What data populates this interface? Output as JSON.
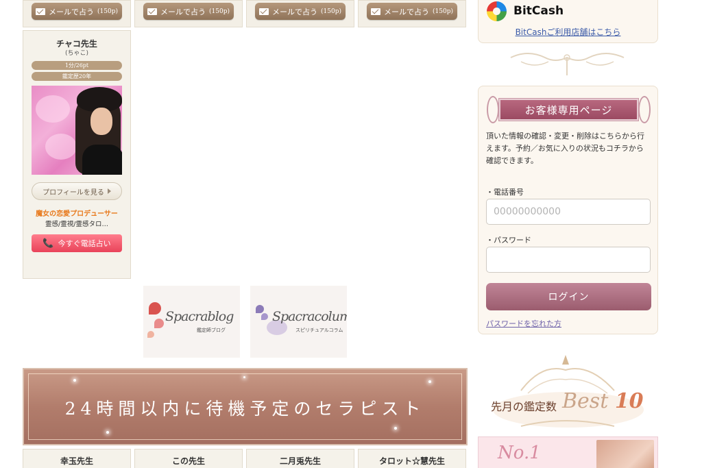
{
  "mail_buttons": [
    {
      "label": "メールで占う",
      "price": "(150p)"
    },
    {
      "label": "メールで占う",
      "price": "(150p)"
    },
    {
      "label": "メールで占う",
      "price": "(150p)"
    },
    {
      "label": "メールで占う",
      "price": "(150p)"
    }
  ],
  "teacher": {
    "name": "チャコ先生",
    "kana": "(ちゃこ)",
    "rate": "1分/26pt",
    "career": "鑑定歴20年",
    "profile_label": "プロフィールを見る",
    "catchphrase": "魔女の恋愛プロデューサー",
    "genres": "霊感/霊視/霊感タロ…",
    "call_label": "今すぐ電話占い"
  },
  "blog_banners": [
    {
      "script": "Spacrablog",
      "sub": "鑑定師ブログ"
    },
    {
      "script": "Spacracolum",
      "sub": "スピリチュアルコラム"
    }
  ],
  "wait_banner": {
    "title": "24時間以内に待機予定のセラピスト"
  },
  "bottom_teachers": [
    "幸玉先生",
    "この先生",
    "二月兎先生",
    "タロット☆慧先生"
  ],
  "sidebar": {
    "bitcash": {
      "name": "BitCash",
      "link": "BitCashご利用店舗はこちら"
    },
    "customer": {
      "title": "お客様専用ページ",
      "description": "頂いた情報の確認・変更・削除はこちらから行えます。予約／お気に入りの状況もコチラから確認できます。",
      "phone_label": "・電話番号",
      "phone_placeholder": "00000000000",
      "password_label": "・パスワード",
      "password_placeholder": "",
      "login_label": "ログイン",
      "forgot_label": "パスワードを忘れた方"
    },
    "best10": {
      "text": "先月の鑑定数",
      "script": "Best",
      "number": "10"
    },
    "rank": {
      "label": "No.1"
    }
  }
}
